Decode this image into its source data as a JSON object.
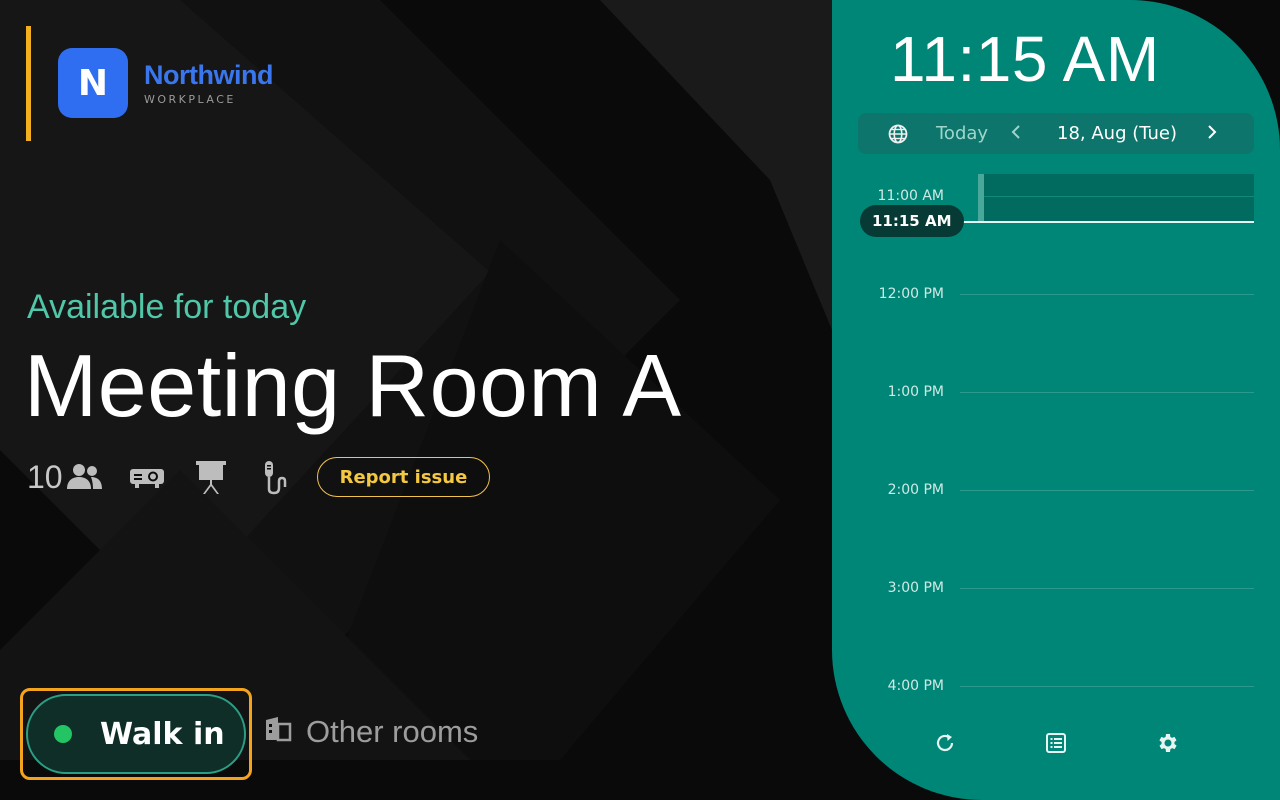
{
  "brand": {
    "name": "Northwind",
    "sub": "WORKPLACE",
    "mark": "N",
    "color": "#3a76ee"
  },
  "room": {
    "status": "Available for today",
    "name": "Meeting Room A",
    "capacity": "10",
    "amenities": [
      "people-icon",
      "projector-icon",
      "presentation-board-icon",
      "microphone-icon"
    ],
    "report_label": "Report issue"
  },
  "actions": {
    "walk_in_label": "Walk in",
    "other_rooms_label": "Other rooms"
  },
  "calendar": {
    "clock": "11:15 AM",
    "today_label": "Today",
    "date": "18, Aug (Tue)",
    "now_label": "11:15 AM",
    "hours": [
      "11:00 AM",
      "12:00 PM",
      "1:00 PM",
      "2:00 PM",
      "3:00 PM",
      "4:00 PM"
    ],
    "tools": [
      "refresh-icon",
      "list-icon",
      "settings-icon"
    ]
  },
  "colors": {
    "panel": "#008677",
    "accent": "#f4a31d",
    "status": "#4fc7a8",
    "available_dot": "#23c463"
  }
}
